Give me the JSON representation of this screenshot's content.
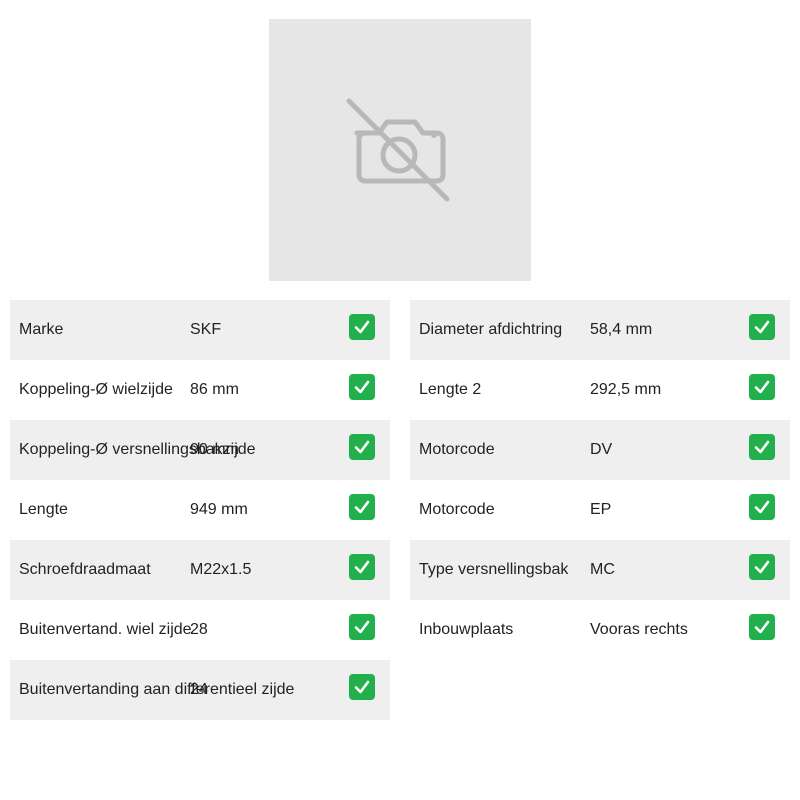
{
  "product_image": {
    "icon": "no-camera-icon"
  },
  "specs_left": [
    {
      "label": "Marke",
      "value": "SKF",
      "icon": "check-mark-icon"
    },
    {
      "label": "Koppeling-Ø wielzijde",
      "value": "86 mm",
      "icon": "check-mark-icon"
    },
    {
      "label": "Koppeling-Ø versnellingsbakzijde",
      "value": "90 mm",
      "icon": "check-mark-icon"
    },
    {
      "label": "Lengte",
      "value": "949 mm",
      "icon": "check-mark-icon"
    },
    {
      "label": "Schroefdraadmaat",
      "value": "M22x1.5",
      "icon": "check-mark-icon"
    },
    {
      "label": "Buitenvertand. wiel zijde",
      "value": "28",
      "icon": "check-mark-icon"
    },
    {
      "label": "Buitenvertanding aan differentieel zijde",
      "value": "24",
      "icon": "check-mark-icon"
    }
  ],
  "specs_right": [
    {
      "label": "Diameter afdichtring",
      "value": "58,4 mm",
      "icon": "check-mark-icon"
    },
    {
      "label": "Lengte 2",
      "value": "292,5 mm",
      "icon": "check-mark-icon"
    },
    {
      "label": "Motorcode",
      "value": "DV",
      "icon": "check-mark-icon"
    },
    {
      "label": "Motorcode",
      "value": "EP",
      "icon": "check-mark-icon"
    },
    {
      "label": "Type versnellingsbak",
      "value": "MC",
      "icon": "check-mark-icon"
    },
    {
      "label": "Inbouwplaats",
      "value": "Vooras rechts",
      "icon": "check-mark-icon"
    }
  ],
  "colors": {
    "row_shaded": "#efefef",
    "check_green": "#22b04c",
    "placeholder_bg": "#e6e6e6",
    "placeholder_icon": "#b8b8b8"
  }
}
